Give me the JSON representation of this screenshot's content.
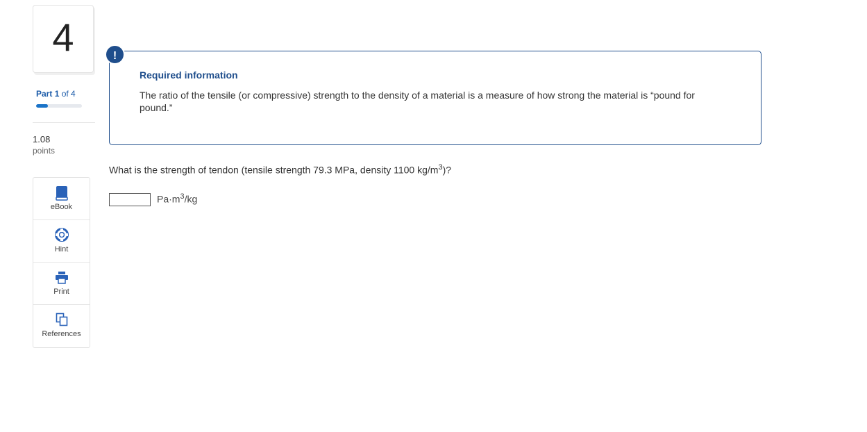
{
  "question": {
    "number": "4",
    "part_word": "Part",
    "part_current": "1",
    "part_of": "of 4",
    "progress_fraction": 0.25,
    "points_value": "1.08",
    "points_label": "points"
  },
  "tools": [
    {
      "label": "eBook",
      "icon": "book-icon"
    },
    {
      "label": "Hint",
      "icon": "lifebuoy-icon"
    },
    {
      "label": "Print",
      "icon": "printer-icon"
    },
    {
      "label": "References",
      "icon": "documents-icon"
    }
  ],
  "required_info": {
    "badge": "!",
    "title": "Required information",
    "text": "The ratio of the tensile (or compressive) strength to the density of a material is a measure of how strong the material is “pound for pound.”"
  },
  "prompt": {
    "text": "What is the strength of tendon (tensile strength 79.3 MPa, density 1100 kg/m",
    "sup": "3",
    "end": ")?"
  },
  "answer": {
    "value": "",
    "unit_prefix": "Pa·m",
    "unit_sup": "3",
    "unit_suffix": "/kg"
  },
  "colors": {
    "accent": "#1f4e8c",
    "progress": "#1a73c8",
    "icon": "#2a62b8"
  }
}
